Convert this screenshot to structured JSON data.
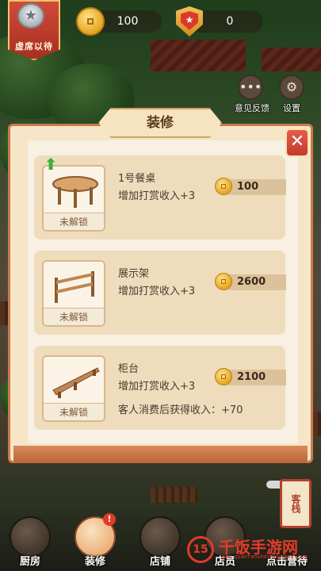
{
  "hud": {
    "rank_label": "虚席以待",
    "coins": "100",
    "badges": "0"
  },
  "side_buttons": {
    "feedback_label": "意见反馈",
    "settings_label": "设置"
  },
  "panel": {
    "title": "装修",
    "close_symbol": "✕",
    "items": [
      {
        "name": "1号餐桌",
        "bonus": "增加打赏收入+3",
        "price": "100",
        "status": "未解锁",
        "extra": ""
      },
      {
        "name": "展示架",
        "bonus": "增加打赏收入+3",
        "price": "2600",
        "status": "未解锁",
        "extra": ""
      },
      {
        "name": "柜台",
        "bonus": "增加打赏收入+3",
        "price": "2100",
        "status": "未解锁",
        "extra": "客人消费后获得收入：+70"
      }
    ]
  },
  "bottom_nav": {
    "items": [
      {
        "label": "厨房",
        "active": false
      },
      {
        "label": "装修",
        "active": true,
        "badge": "!"
      },
      {
        "label": "店铺",
        "active": false
      },
      {
        "label": "店员",
        "active": false
      },
      {
        "label": "点击营待",
        "active": false
      }
    ],
    "inn_sign": "客栈"
  },
  "watermark": {
    "logo": "15",
    "text": "千饭手游网",
    "url": "www.qianfanshouyouwang.com"
  },
  "colors": {
    "panel_bg": "#f6e6c7",
    "card_bg": "#eedcbd",
    "accent_red": "#e23b2b",
    "coin_gold": "#e6a51f"
  }
}
